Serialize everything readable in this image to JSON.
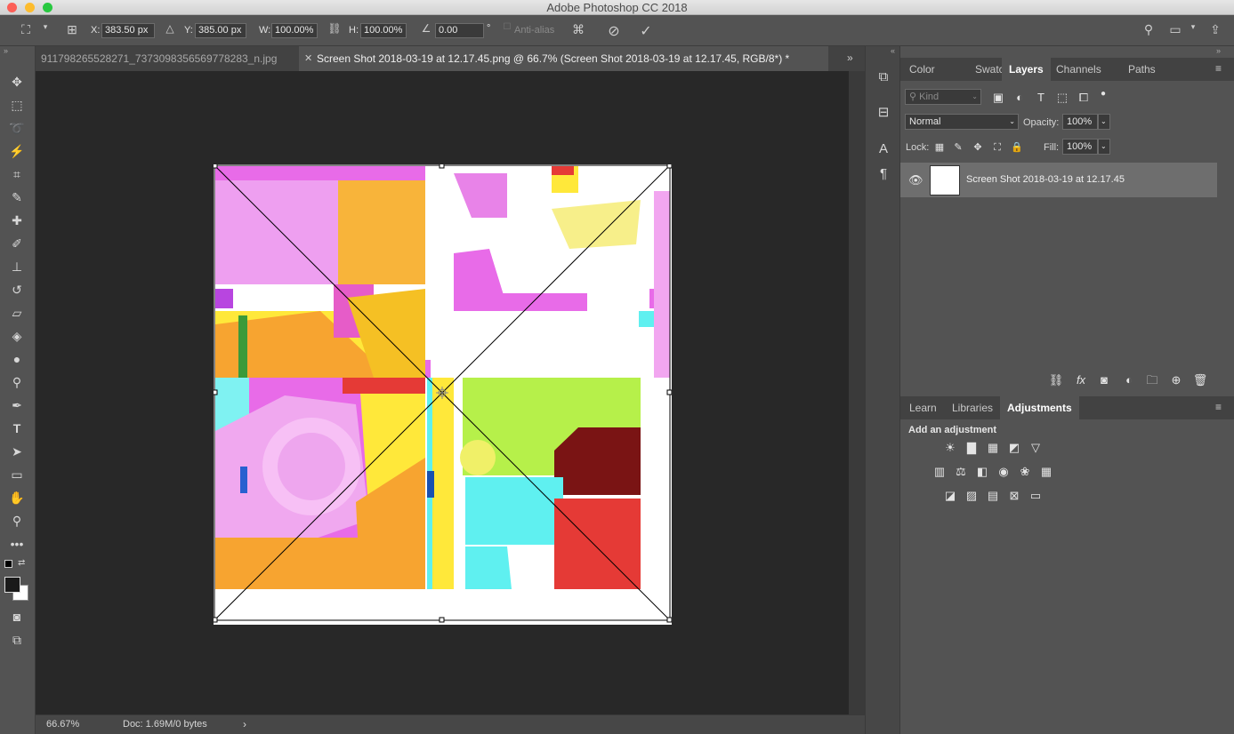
{
  "app": {
    "title": "Adobe Photoshop CC 2018"
  },
  "options": {
    "x_label": "X:",
    "x_value": "383.50 px",
    "y_label": "Y:",
    "y_value": "385.00 px",
    "w_label": "W:",
    "w_value": "100.00%",
    "h_label": "H:",
    "h_value": "100.00%",
    "angle_value": "0.00",
    "angle_unit": "°",
    "antialias_label": "Anti-alias"
  },
  "tabs": [
    {
      "label": "911798265528271_7373098356569778283_n.jpg"
    },
    {
      "label": "Screen Shot 2018-03-19 at 12.17.45.png @ 66.7% (Screen Shot 2018-03-19 at 12.17.45, RGB/8*) *"
    }
  ],
  "status": {
    "zoom": "66.67%",
    "doc": "Doc: 1.69M/0 bytes"
  },
  "top_panel": {
    "tabs": [
      "Color",
      "Swatches",
      "Layers",
      "Channels",
      "Paths"
    ],
    "active_tab": "Layers",
    "kind_placeholder": "Kind",
    "blend_mode": "Normal",
    "opacity_label": "Opacity:",
    "opacity_value": "100%",
    "lock_label": "Lock:",
    "fill_label": "Fill:",
    "fill_value": "100%",
    "layers": [
      {
        "name": "Screen Shot 2018-03-19 at 12.17.45"
      }
    ]
  },
  "bottom_panel": {
    "tabs": [
      "Learn",
      "Libraries",
      "Adjustments"
    ],
    "active_tab": "Adjustments",
    "heading": "Add an adjustment"
  },
  "colors": {
    "magenta": "#e86be8",
    "yellow": "#ffe83a",
    "orange": "#f7a430",
    "red": "#e53a36",
    "cyan": "#5ff0f0",
    "lime": "#b6f04a"
  }
}
